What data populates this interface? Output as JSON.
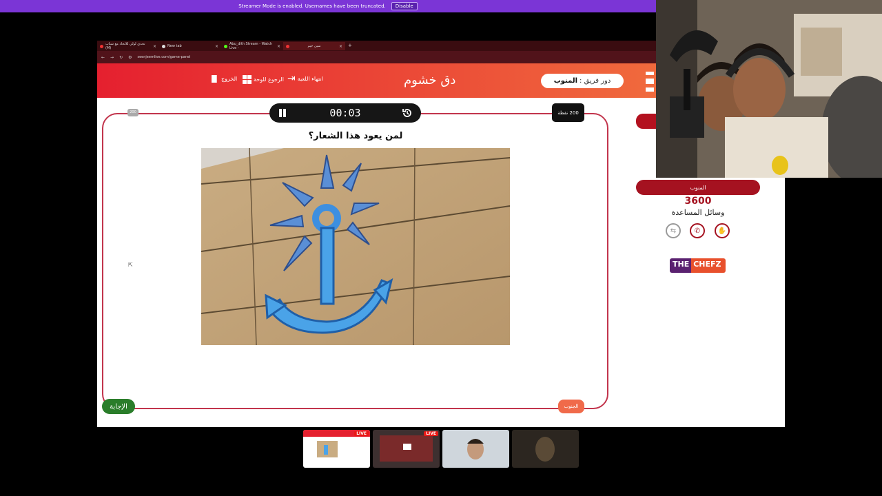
{
  "banner": {
    "text": "Streamer Mode is enabled. Usernames have been truncated.",
    "disable_label": "Disable"
  },
  "browser": {
    "tabs": [
      {
        "label": "تحدي لولي للاتحاد مع شباب (M)",
        "active": false
      },
      {
        "label": "New tab",
        "active": false
      },
      {
        "label": "Abu_dith Stream - Watch Live -",
        "active": false
      },
      {
        "label": "سين جيم",
        "active": true
      }
    ],
    "new_tab": "+",
    "url": "seenjeemlive.com/game-panel"
  },
  "header": {
    "exit_label": "الخروج",
    "back_label": "الرجوع للوحة",
    "end_game_label": "انتهاء اللعبة",
    "game_title": "دق خشوم",
    "turn_prefix": "دور فريق :",
    "turn_team": "المنوب"
  },
  "question": {
    "timer": "00:03",
    "points": "200 نقطة",
    "corner_badge": "200",
    "text": "لمن يعود هذا الشعار؟",
    "answer_label": "الإجابة",
    "team_tag": "الجنوب"
  },
  "team": {
    "name": "المنوب",
    "score": "3600",
    "aids_title": "وسائل المساعدة",
    "aids": [
      "swap-icon",
      "phone-icon",
      "hand-icon"
    ]
  },
  "sponsor": {
    "part1": "THE",
    "part2": "CHEFZ"
  },
  "thumbnails": [
    {
      "live": "LIVE"
    },
    {
      "live": "LIVE"
    },
    {
      "live": ""
    },
    {
      "live": ""
    }
  ],
  "colors": {
    "header_start": "#e5202f",
    "header_end": "#f06a3d",
    "accent_red": "#a51220",
    "answer_green": "#2a7d2a",
    "banner_purple": "#7b35d6"
  }
}
